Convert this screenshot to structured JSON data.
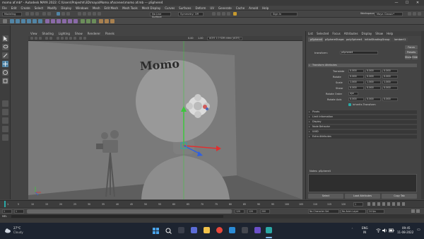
{
  "window": {
    "title": "momo af.mb* - Autodesk MAYA 2022: C:\\Users\\Prajeshh\\3D\\maya\\Momo af\\scenes\\momo af.mb --- pSphere4",
    "min": "—",
    "max": "☐",
    "close": "✕"
  },
  "menu": [
    "File",
    "Edit",
    "Create",
    "Select",
    "Modify",
    "Display",
    "Windows",
    "Mesh",
    "Edit Mesh",
    "Mesh Tools",
    "Mesh Display",
    "Curves",
    "Surfaces",
    "Deform",
    "UV",
    "Generate",
    "Cache",
    "Arnold",
    "Help"
  ],
  "statusline": {
    "menuset": "Modeling",
    "no_live": "No Live Surface",
    "symmetry": "Symmetry: Off",
    "signin": "Sign In",
    "workspace_label": "Workspace:",
    "workspace": "Maya Classic*"
  },
  "viewport": {
    "menu": [
      "View",
      "Shading",
      "Lighting",
      "Show",
      "Renderer",
      "Panels"
    ],
    "gamma_a": "0.00",
    "gamma_b": "1.00",
    "colorspace": "ACES 1.0 SDR-video (ACES)",
    "text_on_board": "Momo"
  },
  "attr": {
    "menu": [
      "List",
      "Selected",
      "Focus",
      "Attributes",
      "Display",
      "Show",
      "Help"
    ],
    "tabs": [
      "pSphere4",
      "pSphereShape4",
      "polySphere4",
      "initialShadingGroup",
      "lambert1"
    ],
    "node_type_label": "transform:",
    "node_name": "pSphere4",
    "btn_focus": "Focus",
    "btn_presets": "Presets",
    "btn_show": "Show",
    "btn_hide": "Hide",
    "section_transform": "Transform Attributes",
    "rows": [
      {
        "label": "Translate",
        "values": [
          "0.000",
          "0.000",
          "0.000"
        ]
      },
      {
        "label": "Rotate",
        "values": [
          "0.000",
          "0.000",
          "0.000"
        ]
      },
      {
        "label": "Scale",
        "values": [
          "1.000",
          "1.000",
          "1.000"
        ]
      },
      {
        "label": "Shear",
        "values": [
          "0.000",
          "0.000",
          "0.000"
        ]
      }
    ],
    "rotate_order_label": "Rotate Order",
    "rotate_order": "xyz",
    "rotate_axis_label": "Rotate Axis",
    "rotate_axis": [
      "0.000",
      "0.000",
      "0.000"
    ],
    "inherits": "Inherits Transform",
    "sections": [
      "Pivots",
      "Limit Information",
      "Display",
      "Node Behavior",
      "UUID",
      "Extra Attributes"
    ],
    "notes_label": "Notes: pSphere4",
    "bottom_buttons": [
      "Select",
      "Load Attributes",
      "Copy Tab"
    ]
  },
  "timeslider": {
    "ticks": [
      "5",
      "10",
      "15",
      "20",
      "25",
      "30",
      "35",
      "40",
      "45",
      "50",
      "55",
      "60",
      "65",
      "70",
      "75",
      "80",
      "85",
      "90",
      "95",
      "100",
      "105",
      "110",
      "115",
      "120"
    ],
    "current_frame": "1"
  },
  "rangeslider": {
    "start": "1",
    "start2": "1",
    "end": "120",
    "end2": "120",
    "end3": "200",
    "character_set": "No Character Set",
    "anim_layer": "No Anim Layer",
    "fps": "24 fps"
  },
  "cmdline": {
    "lang": "MEL"
  },
  "taskbar": {
    "temp": "27°C",
    "weather": "Cloudy",
    "lang": "ENG",
    "region": "IN",
    "time": "09:45",
    "date": "11-08-2022"
  },
  "colors": {
    "accent": "#5285a6",
    "maya_teal": "#2aa9a6",
    "x_axis": "#e03030",
    "y_axis": "#3cc63c",
    "z_axis": "#3060e0"
  }
}
